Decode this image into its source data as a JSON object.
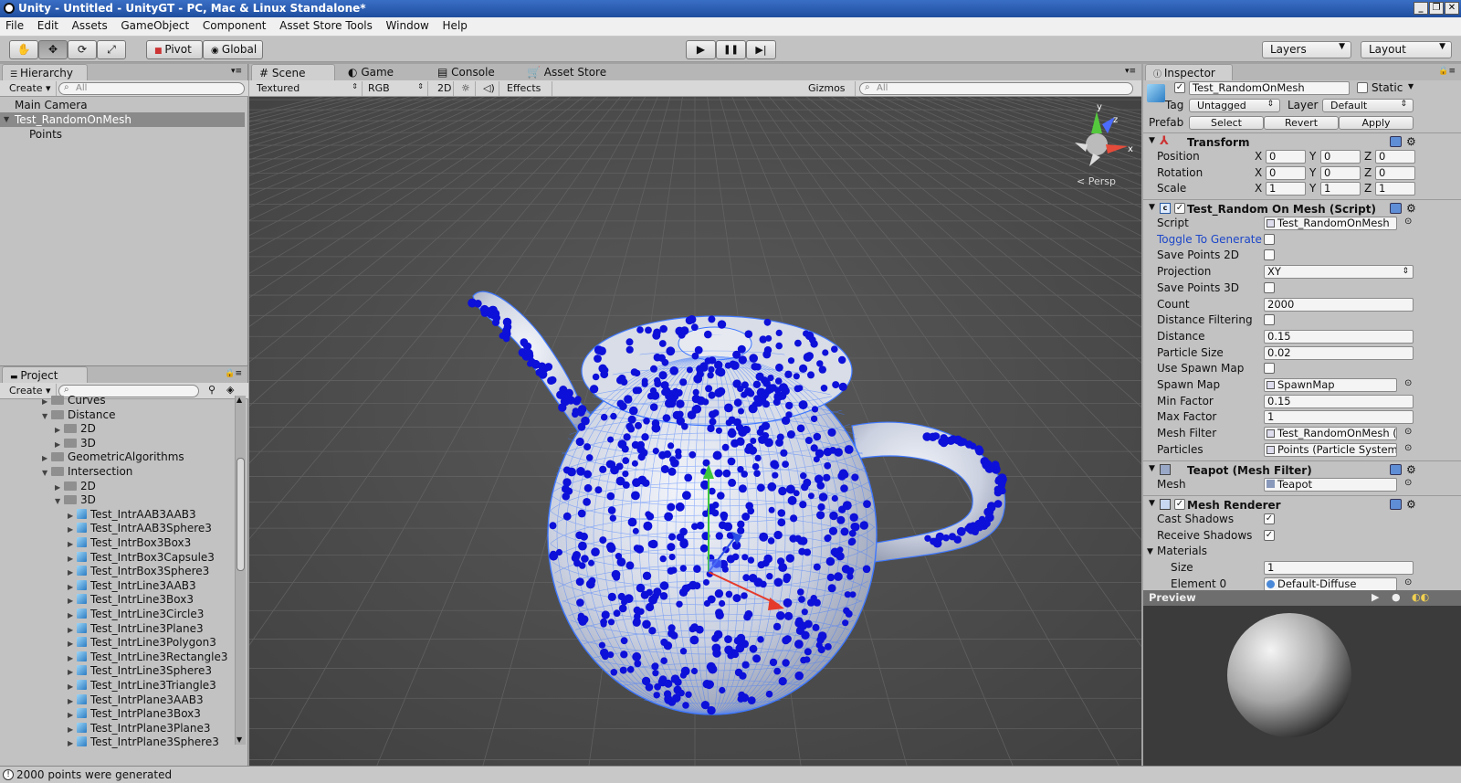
{
  "window": {
    "title": "Unity - Untitled - UnityGT - PC, Mac & Linux Standalone*",
    "min": "_",
    "max": "❐",
    "close": "✕"
  },
  "menu": [
    "File",
    "Edit",
    "Assets",
    "GameObject",
    "Component",
    "Asset Store Tools",
    "Window",
    "Help"
  ],
  "toolbar": {
    "tools": [
      {
        "icon": "hand-icon",
        "glyph": "✋"
      },
      {
        "icon": "move-icon",
        "glyph": "✥"
      },
      {
        "icon": "rotate-icon",
        "glyph": "⟳"
      },
      {
        "icon": "scale-icon",
        "glyph": "⤢"
      }
    ],
    "pivot_label": "Pivot",
    "global_label": "Global",
    "play_glyph": "▶",
    "pause_glyph": "❚❚",
    "step_glyph": "▶|",
    "layers_label": "Layers",
    "layout_label": "Layout"
  },
  "hierarchy": {
    "tab": "Hierarchy",
    "create": "Create",
    "search_placeholder": "All",
    "items": [
      {
        "label": "Main Camera",
        "selected": false,
        "indent": 0
      },
      {
        "label": "Test_RandomOnMesh",
        "selected": true,
        "indent": 0,
        "expanded": true
      },
      {
        "label": "Points",
        "selected": false,
        "indent": 1
      }
    ]
  },
  "project": {
    "tab": "Project",
    "create": "Create",
    "tree": [
      {
        "label": "Curves",
        "level": 0,
        "type": "folder",
        "fold": "▶"
      },
      {
        "label": "Distance",
        "level": 0,
        "type": "folder",
        "fold": "▼"
      },
      {
        "label": "2D",
        "level": 1,
        "type": "folder",
        "fold": "▶"
      },
      {
        "label": "3D",
        "level": 1,
        "type": "folder",
        "fold": "▶"
      },
      {
        "label": "GeometricAlgorithms",
        "level": 0,
        "type": "folder",
        "fold": "▶"
      },
      {
        "label": "Intersection",
        "level": 0,
        "type": "folder",
        "fold": "▼"
      },
      {
        "label": "2D",
        "level": 1,
        "type": "folder",
        "fold": "▶"
      },
      {
        "label": "3D",
        "level": 1,
        "type": "folder",
        "fold": "▼"
      },
      {
        "label": "Test_IntrAAB3AAB3",
        "level": 2,
        "type": "prefab",
        "fold": "▶"
      },
      {
        "label": "Test_IntrAAB3Sphere3",
        "level": 2,
        "type": "prefab",
        "fold": "▶"
      },
      {
        "label": "Test_IntrBox3Box3",
        "level": 2,
        "type": "prefab",
        "fold": "▶"
      },
      {
        "label": "Test_IntrBox3Capsule3",
        "level": 2,
        "type": "prefab",
        "fold": "▶"
      },
      {
        "label": "Test_IntrBox3Sphere3",
        "level": 2,
        "type": "prefab",
        "fold": "▶"
      },
      {
        "label": "Test_IntrLine3AAB3",
        "level": 2,
        "type": "prefab",
        "fold": "▶"
      },
      {
        "label": "Test_IntrLine3Box3",
        "level": 2,
        "type": "prefab",
        "fold": "▶"
      },
      {
        "label": "Test_IntrLine3Circle3",
        "level": 2,
        "type": "prefab",
        "fold": "▶"
      },
      {
        "label": "Test_IntrLine3Plane3",
        "level": 2,
        "type": "prefab",
        "fold": "▶"
      },
      {
        "label": "Test_IntrLine3Polygon3",
        "level": 2,
        "type": "prefab",
        "fold": "▶"
      },
      {
        "label": "Test_IntrLine3Rectangle3",
        "level": 2,
        "type": "prefab",
        "fold": "▶"
      },
      {
        "label": "Test_IntrLine3Sphere3",
        "level": 2,
        "type": "prefab",
        "fold": "▶"
      },
      {
        "label": "Test_IntrLine3Triangle3",
        "level": 2,
        "type": "prefab",
        "fold": "▶"
      },
      {
        "label": "Test_IntrPlane3AAB3",
        "level": 2,
        "type": "prefab",
        "fold": "▶"
      },
      {
        "label": "Test_IntrPlane3Box3",
        "level": 2,
        "type": "prefab",
        "fold": "▶"
      },
      {
        "label": "Test_IntrPlane3Plane3",
        "level": 2,
        "type": "prefab",
        "fold": "▶"
      },
      {
        "label": "Test_IntrPlane3Sphere3",
        "level": 2,
        "type": "prefab",
        "fold": "▶"
      }
    ]
  },
  "scene": {
    "tabs": [
      "Scene",
      "Game",
      "Console",
      "Asset Store"
    ],
    "tab_glyphs": [
      "#",
      "◐",
      "▤",
      "🛒"
    ],
    "shading": "Textured",
    "render_mode": "RGB",
    "mode_2d": "2D",
    "sun_glyph": "☼",
    "audio_glyph": "◁)",
    "effects": "Effects",
    "gizmos": "Gizmos",
    "search_placeholder": "All",
    "persp_label": "Persp",
    "axis_y": "y",
    "axis_z": "z",
    "axis_x": "x",
    "point_color": "#0d10d8",
    "mesh_color": "#3f78ff"
  },
  "inspector": {
    "tab": "Inspector",
    "object_name": "Test_RandomOnMesh",
    "active_check": "✓",
    "static_label": "Static",
    "tag_label": "Tag",
    "tag_value": "Untagged",
    "layer_label": "Layer",
    "layer_value": "Default",
    "prefab_label": "Prefab",
    "prefab_select": "Select",
    "prefab_revert": "Revert",
    "prefab_apply": "Apply",
    "transform": {
      "title": "Transform",
      "rows": [
        {
          "label": "Position",
          "x": "0",
          "y": "0",
          "z": "0"
        },
        {
          "label": "Rotation",
          "x": "0",
          "y": "0",
          "z": "0"
        },
        {
          "label": "Scale",
          "x": "1",
          "y": "1",
          "z": "1"
        }
      ]
    },
    "script_comp": {
      "title": "Test_Random On Mesh (Script)",
      "rows": [
        {
          "label": "Script",
          "type": "ref",
          "value": "Test_RandomOnMesh"
        },
        {
          "label": "Toggle To Generate",
          "type": "check",
          "checked": false,
          "highlight": true
        },
        {
          "label": "Save Points 2D",
          "type": "check",
          "checked": false
        },
        {
          "label": "Projection",
          "type": "enum",
          "value": "XY"
        },
        {
          "label": "Save Points 3D",
          "type": "check",
          "checked": false
        },
        {
          "label": "Count",
          "type": "text",
          "value": "2000"
        },
        {
          "label": "Distance Filtering",
          "type": "check",
          "checked": false
        },
        {
          "label": "Distance",
          "type": "text",
          "value": "0.15"
        },
        {
          "label": "Particle Size",
          "type": "text",
          "value": "0.02"
        },
        {
          "label": "Use Spawn Map",
          "type": "check",
          "checked": false
        },
        {
          "label": "Spawn Map",
          "type": "ref",
          "value": "SpawnMap"
        },
        {
          "label": "Min Factor",
          "type": "text",
          "value": "0.15"
        },
        {
          "label": "Max Factor",
          "type": "text",
          "value": "1"
        },
        {
          "label": "Mesh Filter",
          "type": "ref",
          "value": "Test_RandomOnMesh (Mesh Filter)"
        },
        {
          "label": "Particles",
          "type": "ref",
          "value": "Points (Particle System)"
        }
      ]
    },
    "mesh_filter": {
      "title": "Teapot (Mesh Filter)",
      "mesh_label": "Mesh",
      "mesh_value": "Teapot"
    },
    "mesh_renderer": {
      "title": "Mesh Renderer",
      "cast_shadows_label": "Cast Shadows",
      "receive_shadows_label": "Receive Shadows",
      "materials_label": "Materials",
      "size_label": "Size",
      "size_value": "1",
      "element0_label": "Element 0",
      "element0_value": "Default-Diffuse"
    }
  },
  "preview": {
    "label": "Preview"
  },
  "status": {
    "message": "2000 points were generated"
  }
}
